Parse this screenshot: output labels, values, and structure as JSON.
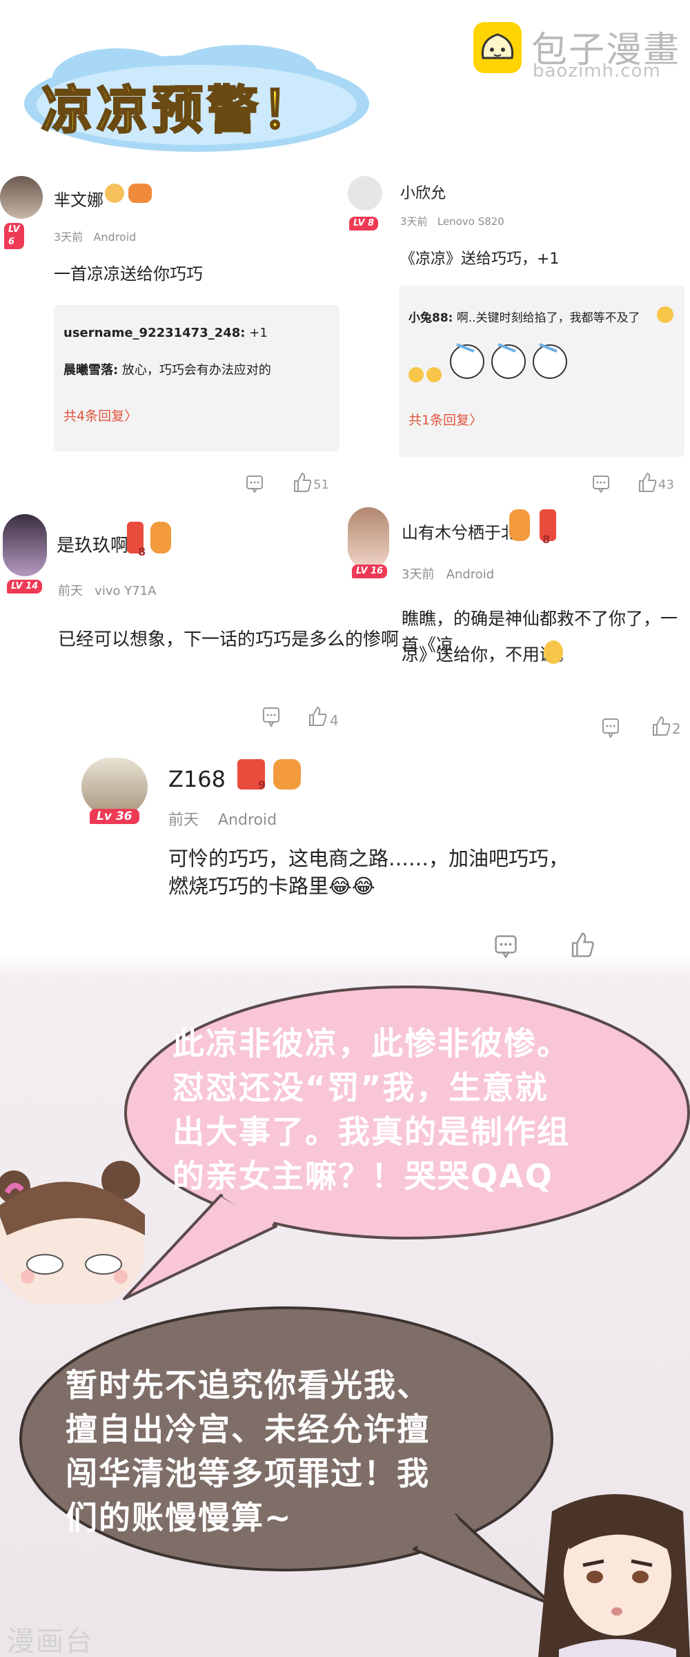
{
  "banner": {
    "title": "凉凉预警！"
  },
  "watermark": {
    "site_name": "包子漫畫",
    "site_url": "baozimh.com",
    "footer": "漫画台"
  },
  "comments": [
    {
      "user": "芈文娜",
      "level": "LV 6",
      "time": "3天前",
      "device": "Android",
      "text": "一首凉凉送给你巧巧",
      "replies": [
        {
          "user": "username_92231473_248:",
          "text": " +1"
        },
        {
          "user": "晨曦雪落:",
          "text": " 放心，巧巧会有办法应对的"
        }
      ],
      "more": "共4条回复〉",
      "likes": "51"
    },
    {
      "user": "小欣允",
      "level": "LV 8",
      "time": "3天前",
      "device": "Lenovo S820",
      "text": "《凉凉》送给巧巧，+1",
      "replies": [
        {
          "user": "小兔88:",
          "text": " 啊..关键时刻给掐了，我都等不及了"
        }
      ],
      "more": "共1条回复〉",
      "likes": "43"
    },
    {
      "user": "是玖玖啊",
      "level": "LV 14",
      "time": "前天",
      "device": "vivo Y71A",
      "medal_num": "8",
      "text": "已经可以想象，下一话的巧巧是多么的惨啊",
      "likes": "4"
    },
    {
      "user": "山有木兮栖于北",
      "level": "LV 16",
      "time": "3天前",
      "device": "Android",
      "medal_num": "8",
      "text_line1": "瞧瞧，的确是神仙都救不了你了，一首《凉",
      "text_line2": "凉》送给你，不用谢。",
      "likes": "2"
    },
    {
      "user": "Z168",
      "level": "Lv 36",
      "time": "前天",
      "device": "Android",
      "medal_num": "9",
      "text_line1": "可怜的巧巧，这电商之路……，加油吧巧巧，",
      "text_line2": "燃烧巧巧的卡路里😂😂"
    }
  ],
  "bubbles": {
    "heroine": [
      "此凉非彼凉，此惨非彼惨。",
      "怼怼还没“罚”我，生意就",
      "出大事了。我真的是制作组",
      "的亲女主嘛？！哭哭QAQ"
    ],
    "emperor": [
      "暂时先不追究你看光我、",
      "擅自出冷宫、未经允许擅",
      "闯华清池等多项罪过！我",
      "们的账慢慢算~"
    ]
  },
  "colors": {
    "level_badge": "#ee3a55",
    "reply_more": "#e2533c",
    "banner_title": "#ffe230",
    "bubble_pink": "#f8c6d6",
    "bubble_brown": "#7f6e68"
  }
}
